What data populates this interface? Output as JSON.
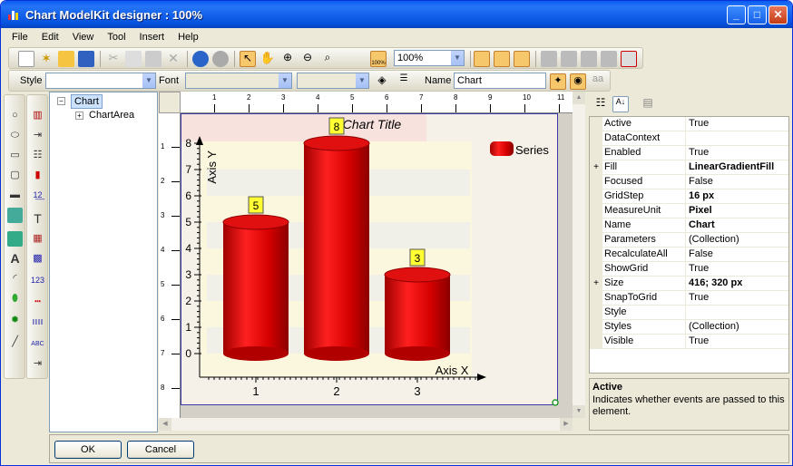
{
  "window": {
    "title": "Chart ModelKit designer : 100%",
    "min": "_",
    "max": "□",
    "close": "✕"
  },
  "menu": [
    "File",
    "Edit",
    "View",
    "Tool",
    "Insert",
    "Help"
  ],
  "toolbar": {
    "zoom": "100%",
    "zoom_icon": "100%"
  },
  "formatbar": {
    "style_label": "Style",
    "style_value": "",
    "font_label": "Font",
    "font_value": "",
    "size_value": "",
    "name_label": "Name",
    "name_value": "Chart"
  },
  "tree": {
    "root": "Chart",
    "child": "ChartArea",
    "expander": "+",
    "collapser": "−"
  },
  "rulers": {
    "top": [
      "1",
      "2",
      "3",
      "4",
      "5",
      "6",
      "7",
      "8",
      "9",
      "10",
      "11"
    ],
    "left": [
      "1",
      "2",
      "3",
      "4",
      "5",
      "6",
      "7",
      "8"
    ]
  },
  "chart": {
    "title": "Chart Title",
    "legend": "Series",
    "xlabel": "Axis X",
    "ylabel": "Axis Y"
  },
  "chart_data": {
    "type": "bar",
    "title": "Chart Title",
    "xlabel": "Axis X",
    "ylabel": "Axis Y",
    "categories": [
      "1",
      "2",
      "3"
    ],
    "series": [
      {
        "name": "Series",
        "values": [
          5,
          8,
          3
        ]
      }
    ],
    "yticks": [
      "0",
      "1",
      "2",
      "3",
      "4",
      "5",
      "6",
      "7",
      "8"
    ],
    "ylim": [
      0,
      8
    ],
    "legend": "top-right",
    "grid": false,
    "bar_color": "#d40000"
  },
  "properties": [
    {
      "name": "Active",
      "value": "True",
      "bold": false,
      "exp": false
    },
    {
      "name": "DataContext",
      "value": "",
      "bold": false,
      "exp": false
    },
    {
      "name": "Enabled",
      "value": "True",
      "bold": false,
      "exp": false
    },
    {
      "name": "Fill",
      "value": "LinearGradientFill",
      "bold": true,
      "exp": true
    },
    {
      "name": "Focused",
      "value": "False",
      "bold": false,
      "exp": false
    },
    {
      "name": "GridStep",
      "value": "16 px",
      "bold": true,
      "exp": false
    },
    {
      "name": "MeasureUnit",
      "value": "Pixel",
      "bold": true,
      "exp": false
    },
    {
      "name": "Name",
      "value": "Chart",
      "bold": true,
      "exp": false
    },
    {
      "name": "Parameters",
      "value": "(Collection)",
      "bold": false,
      "exp": false
    },
    {
      "name": "RecalculateAll",
      "value": "False",
      "bold": false,
      "exp": false
    },
    {
      "name": "ShowGrid",
      "value": "True",
      "bold": false,
      "exp": false
    },
    {
      "name": "Size",
      "value": "416; 320 px",
      "bold": true,
      "exp": true
    },
    {
      "name": "SnapToGrid",
      "value": "True",
      "bold": false,
      "exp": false
    },
    {
      "name": "Style",
      "value": "",
      "bold": false,
      "exp": false
    },
    {
      "name": "Styles",
      "value": "(Collection)",
      "bold": false,
      "exp": false
    },
    {
      "name": "Visible",
      "value": "True",
      "bold": false,
      "exp": false
    }
  ],
  "description": {
    "title": "Active",
    "text": "Indicates whether events are passed to this element."
  },
  "buttons": {
    "ok": "OK",
    "cancel": "Cancel"
  },
  "toolbox": {
    "text_tool": "T",
    "label_tool": "A",
    "num_tool": "123",
    "abc_tool": "ABC"
  },
  "expand_glyph": "+"
}
